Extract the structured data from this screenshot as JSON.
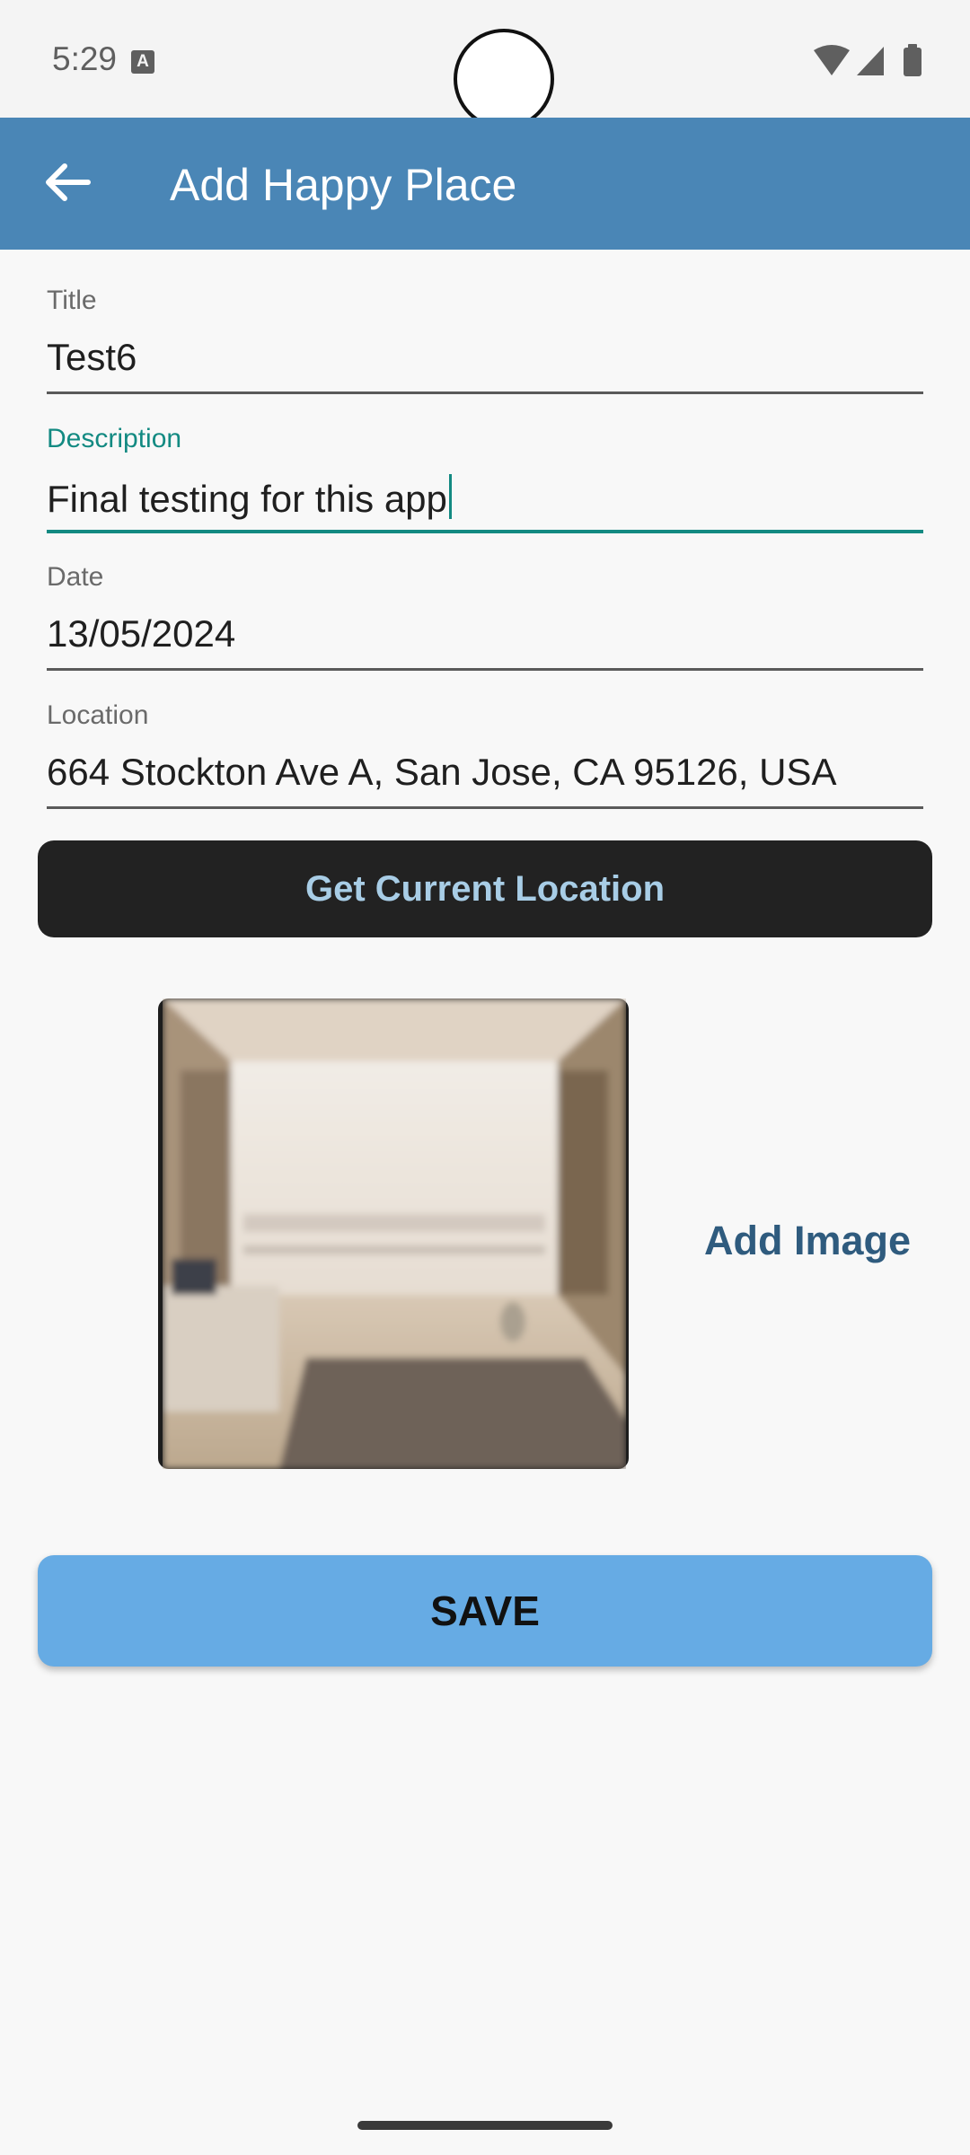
{
  "status_bar": {
    "time": "5:29",
    "notification_icon": "keyboard-a-icon",
    "icons": [
      "wifi-icon",
      "cell-signal-icon",
      "battery-icon"
    ]
  },
  "app_bar": {
    "title": "Add Happy Place",
    "back_icon": "arrow-left-icon",
    "background_color": "#4a86b6"
  },
  "form": {
    "title": {
      "label": "Title",
      "value": "Test6"
    },
    "description": {
      "label": "Description",
      "value": "Final testing for this app",
      "focused": true
    },
    "date": {
      "label": "Date",
      "value": "13/05/2024"
    },
    "location": {
      "label": "Location",
      "value": "664 Stockton Ave A, San Jose, CA 95126, USA"
    }
  },
  "buttons": {
    "get_location": "Get Current Location",
    "add_image": "Add Image",
    "save": "SAVE"
  },
  "colors": {
    "accent": "#138a82",
    "location_button_bg": "#222222",
    "location_button_text": "#a8cde6",
    "save_button_bg": "#66abe4",
    "add_image_text": "#2f5b7e"
  }
}
